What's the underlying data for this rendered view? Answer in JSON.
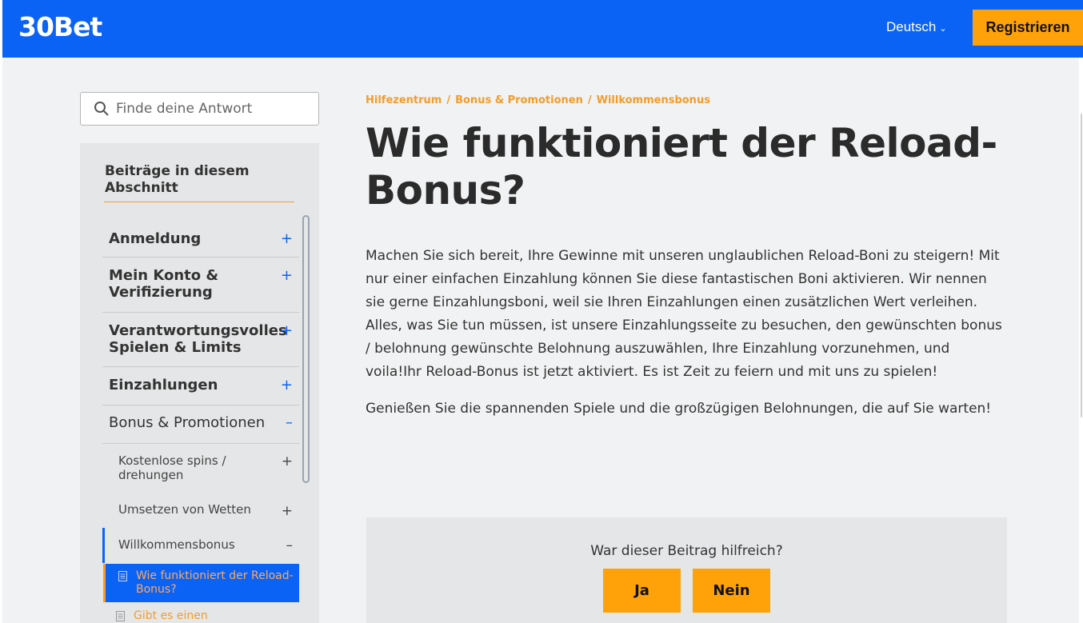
{
  "header": {
    "logo": "30Bet",
    "language": "Deutsch",
    "register_label": "Registrieren",
    "brand_color": "#0b63f6",
    "accent_color": "#ffa20a"
  },
  "search": {
    "placeholder": "Finde deine Antwort"
  },
  "sidebar": {
    "title": "Beiträge in diesem Abschnitt",
    "items": [
      {
        "label": "Anmeldung",
        "sign": "+"
      },
      {
        "label": "Mein Konto & Verifizierung",
        "sign": "+"
      },
      {
        "label": "Verantwortungsvolles Spielen & Limits",
        "sign": "+"
      },
      {
        "label": "Einzahlungen",
        "sign": "+"
      },
      {
        "label": "Bonus & Promotionen",
        "sign": "–"
      }
    ],
    "subitems": [
      {
        "label": "Kostenlose spins / drehungen",
        "sign": "+"
      },
      {
        "label": "Umsetzen von Wetten",
        "sign": "+"
      },
      {
        "label": "Willkommensbonus",
        "sign": "–"
      }
    ],
    "articles": [
      {
        "label": "Wie funktioniert der Reload-Bonus?"
      },
      {
        "label": "Gibt es einen"
      }
    ]
  },
  "breadcrumb": [
    "Hilfezentrum",
    "Bonus & Promotionen",
    "Willkommensbonus"
  ],
  "article": {
    "title": "Wie funktioniert der Reload-Bonus?",
    "paragraphs": [
      "Machen Sie sich bereit, Ihre Gewinne mit unseren unglaublichen Reload-Boni zu steigern! Mit nur einer einfachen Einzahlung können Sie diese fantastischen Boni aktivieren. Wir nennen sie gerne Einzahlungsboni, weil sie Ihren Einzahlungen einen zusätzlichen Wert verleihen. Alles, was Sie tun müssen, ist unsere Einzahlungsseite zu besuchen, den gewünschten bonus / belohnung gewünschte Belohnung auszuwählen, Ihre Einzahlung vorzunehmen, und voila!Ihr Reload-Bonus ist jetzt aktiviert. Es ist Zeit zu feiern und mit uns zu spielen!",
      "Genießen Sie die spannenden Spiele und die großzügigen Belohnungen, die auf Sie warten!"
    ]
  },
  "feedback": {
    "question": "War dieser Beitrag hilfreich?",
    "yes_label": "Ja",
    "no_label": "Nein"
  }
}
